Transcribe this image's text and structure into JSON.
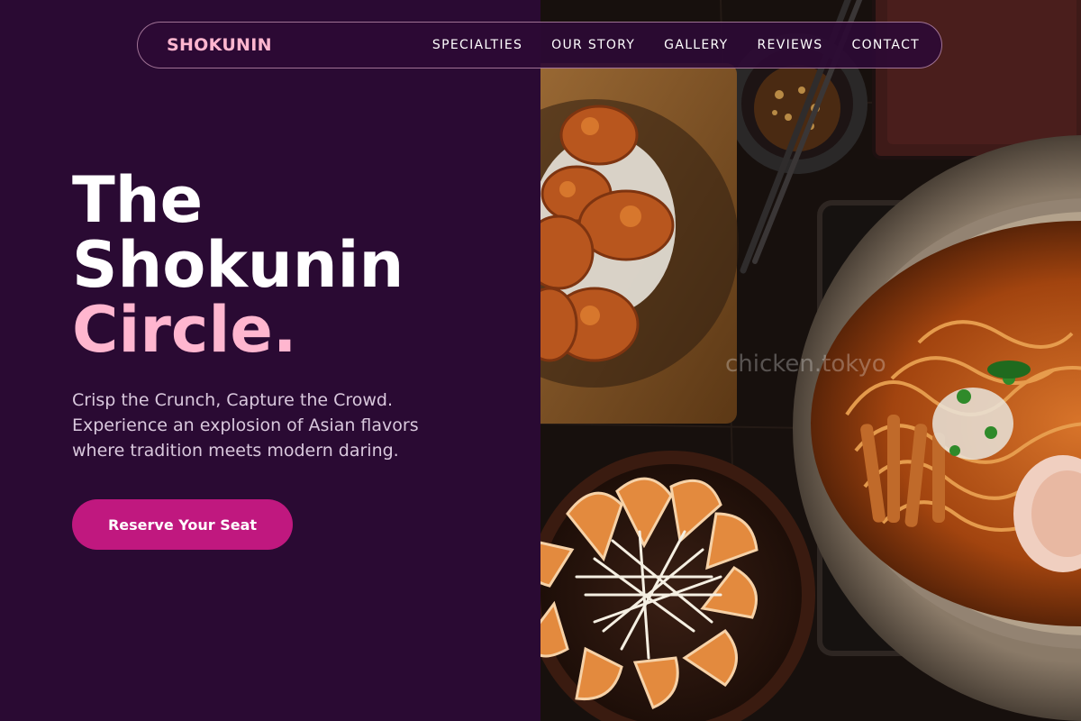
{
  "nav": {
    "brand": "SHOKUNIN",
    "links": [
      "SPECIALTIES",
      "OUR STORY",
      "GALLERY",
      "REVIEWS",
      "CONTACT"
    ]
  },
  "hero": {
    "title_line1": "The",
    "title_line2": "Shokunin",
    "title_accent": "Circle.",
    "subtitle_line1": "Crisp the Crunch, Capture the Crowd.",
    "subtitle_line2": "Experience an explosion of Asian flavors",
    "subtitle_line3": "where tradition meets modern daring.",
    "cta_label": "Reserve Your Seat"
  },
  "photo": {
    "watermark": "chicken.tokyo",
    "subjects": [
      "karaage-plate",
      "gyoza-plate",
      "ramen-bowl",
      "pickles-dish",
      "chopsticks"
    ]
  },
  "colors": {
    "background": "#2a0a33",
    "accent_pink": "#ffb6cf",
    "cta_magenta": "#c0187f",
    "text_muted": "#d9c8dd"
  }
}
